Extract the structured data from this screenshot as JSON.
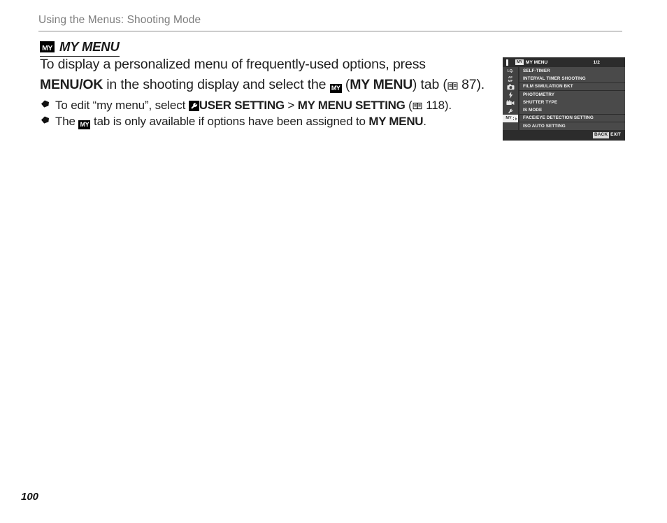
{
  "header": {
    "breadcrumb": "Using the Menus: Shooting Mode"
  },
  "section": {
    "icon": "my-menu-badge-icon",
    "title": "MY MENU"
  },
  "body": {
    "paragraph_part1": "To display a personalized menu of frequently-used options, press ",
    "menu_ok_label": "MENU/OK",
    "paragraph_part2": " in the shooting display and select the ",
    "my_icon_label": "MY",
    "paragraph_part3": " (",
    "my_menu_bold": "MY MENU",
    "paragraph_part4": ") tab (",
    "page_ref_1": "87",
    "paragraph_part5": ")."
  },
  "notes": [
    {
      "bullet": "diamond-bullet-icon",
      "part1": "To edit “my menu”, select ",
      "icon": "user-setting-wrench-icon",
      "bold1": "USER SETTING",
      "part2": " > ",
      "bold2": "MY MENU SETTING",
      "part3": " (",
      "page_ref": "118",
      "part4": ")."
    },
    {
      "bullet": "diamond-bullet-icon",
      "part1": "The ",
      "icon": "my-menu-badge-icon",
      "part2": " tab is only available if options have been assigned to ",
      "bold1": "MY MENU",
      "part3": "."
    }
  ],
  "lcd": {
    "title_badge": "MY",
    "title": "MY MENU",
    "page_indicator": "1/2",
    "sidebar_tabs": [
      {
        "name": "image-quality-tab",
        "label": "I.Q.",
        "selected": false
      },
      {
        "name": "af-mf-tab",
        "label": "AF/MF",
        "selected": false
      },
      {
        "name": "shooting-setting-tab",
        "label": "camera-icon",
        "selected": false
      },
      {
        "name": "flash-setting-tab",
        "label": "flash-icon",
        "selected": false
      },
      {
        "name": "movie-setting-tab",
        "label": "movie-camera-icon",
        "selected": false
      },
      {
        "name": "set-up-tab",
        "label": "wrench-icon",
        "selected": false
      },
      {
        "name": "my-menu-tab",
        "label": "MY",
        "selected": true
      }
    ],
    "items": [
      "SELF-TIMER",
      "INTERVAL TIMER SHOOTING",
      "FILM SIMULATION BKT",
      "PHOTOMETRY",
      "SHUTTER TYPE",
      "IS MODE",
      "FACE/EYE DETECTION SETTING",
      "ISO AUTO SETTING"
    ],
    "footer": {
      "back_label": "BACK",
      "exit_label": "EXIT"
    }
  },
  "folio": {
    "page_number": "100"
  },
  "colors": {
    "lcd_background": "#2c2c2c",
    "lcd_row": "#4a4a4a",
    "lcd_sidebar": "#424242",
    "lcd_selected": "#f0f0f0",
    "rule": "#8c8c8c",
    "breadcrumb_text": "#7d7d7d"
  }
}
